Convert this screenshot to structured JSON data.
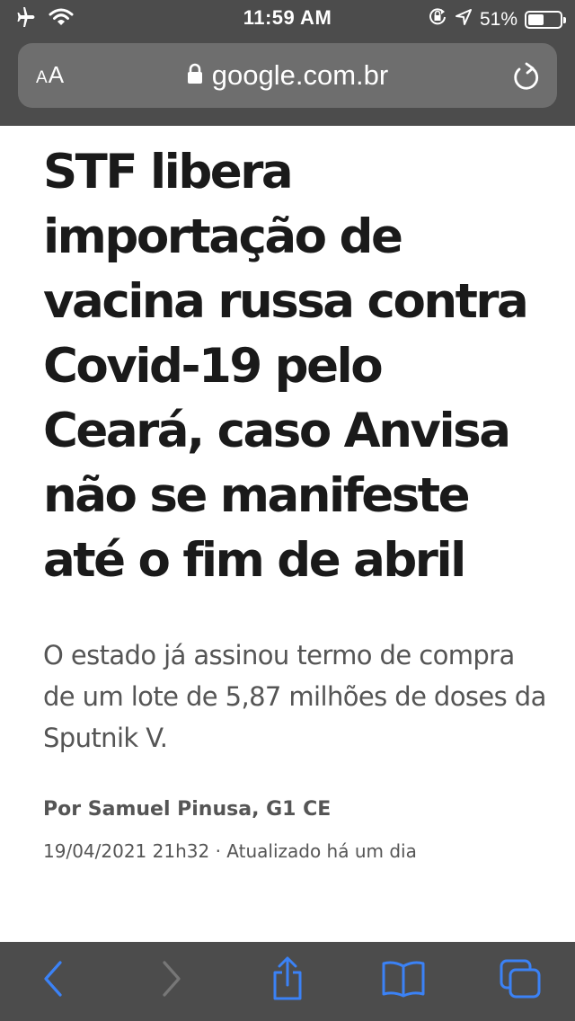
{
  "status_bar": {
    "time": "11:59 AM",
    "battery_percent": "51%",
    "battery_level": 0.51,
    "icons": [
      "airplane-icon",
      "wifi-icon",
      "orientation-lock-icon",
      "location-icon",
      "battery-icon"
    ]
  },
  "browser": {
    "text_size_button": {
      "small": "A",
      "large": "A"
    },
    "url": "google.com.br",
    "icons": [
      "lock-icon",
      "reload-icon"
    ]
  },
  "article": {
    "headline": "STF libera importação de vacina russa contra Covid-19 pelo Ceará, caso Anvisa não se manifeste até o fim de abril",
    "summary": "O estado já assinou termo de compra de um lote de 5,87 milhões de doses da Sputnik V.",
    "byline": "Por Samuel Pinusa, G1 CE",
    "dateline": "19/04/2021 21h32 · Atualizado há um dia"
  },
  "toolbar": {
    "icons": [
      "back-icon",
      "forward-icon",
      "share-icon",
      "bookmarks-icon",
      "tabs-icon"
    ],
    "accent_color": "#3b82f6",
    "disabled_color": "#777777"
  },
  "colors": {
    "chrome_background": "#4c4c4c",
    "url_field": "#6e6e6e",
    "headline": "#1a1a1a",
    "body_text": "#555555"
  }
}
